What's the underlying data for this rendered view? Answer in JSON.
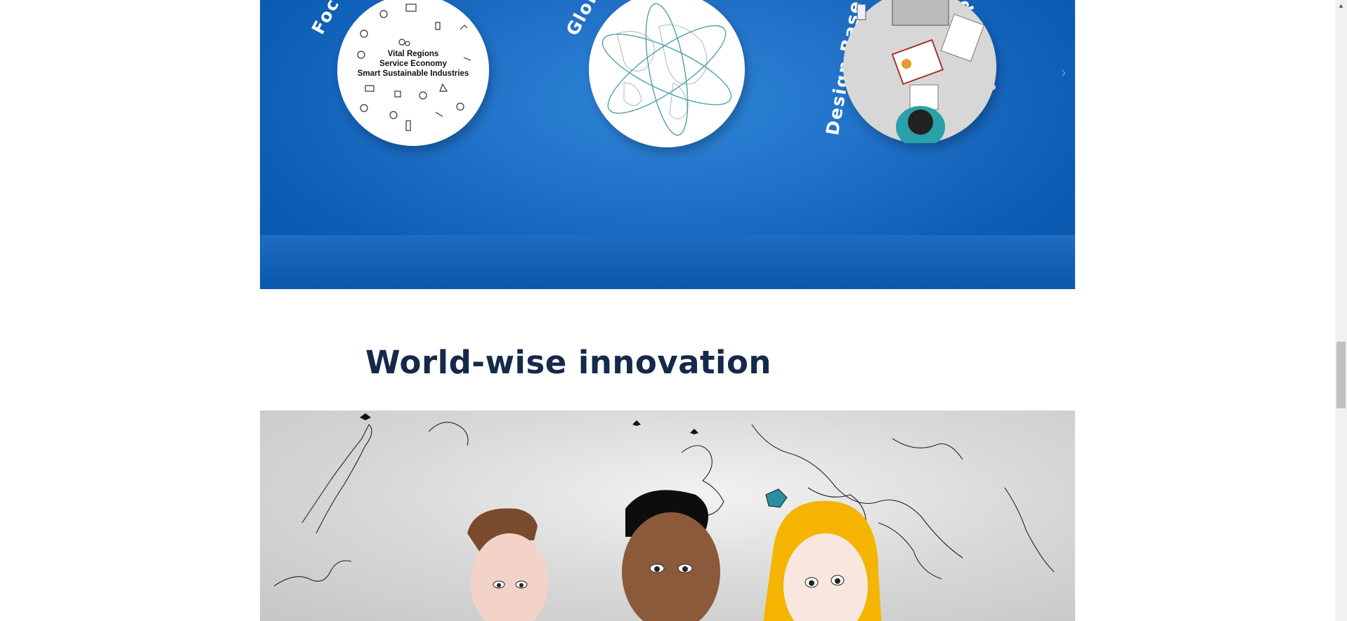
{
  "hero": {
    "labels": [
      "Focus ...",
      "Global",
      "proach",
      "Design Based",
      "ducation"
    ],
    "circle1_lines": [
      "Vital Regions",
      "Service Economy",
      "Smart Sustainable Industries"
    ],
    "next_arrow": "›",
    "colors": {
      "blue": "#0b5cb4",
      "accent": "#1f6fc6"
    }
  },
  "section": {
    "heading": "World-wise innovation"
  },
  "scrollbar": {
    "up": "▲"
  }
}
